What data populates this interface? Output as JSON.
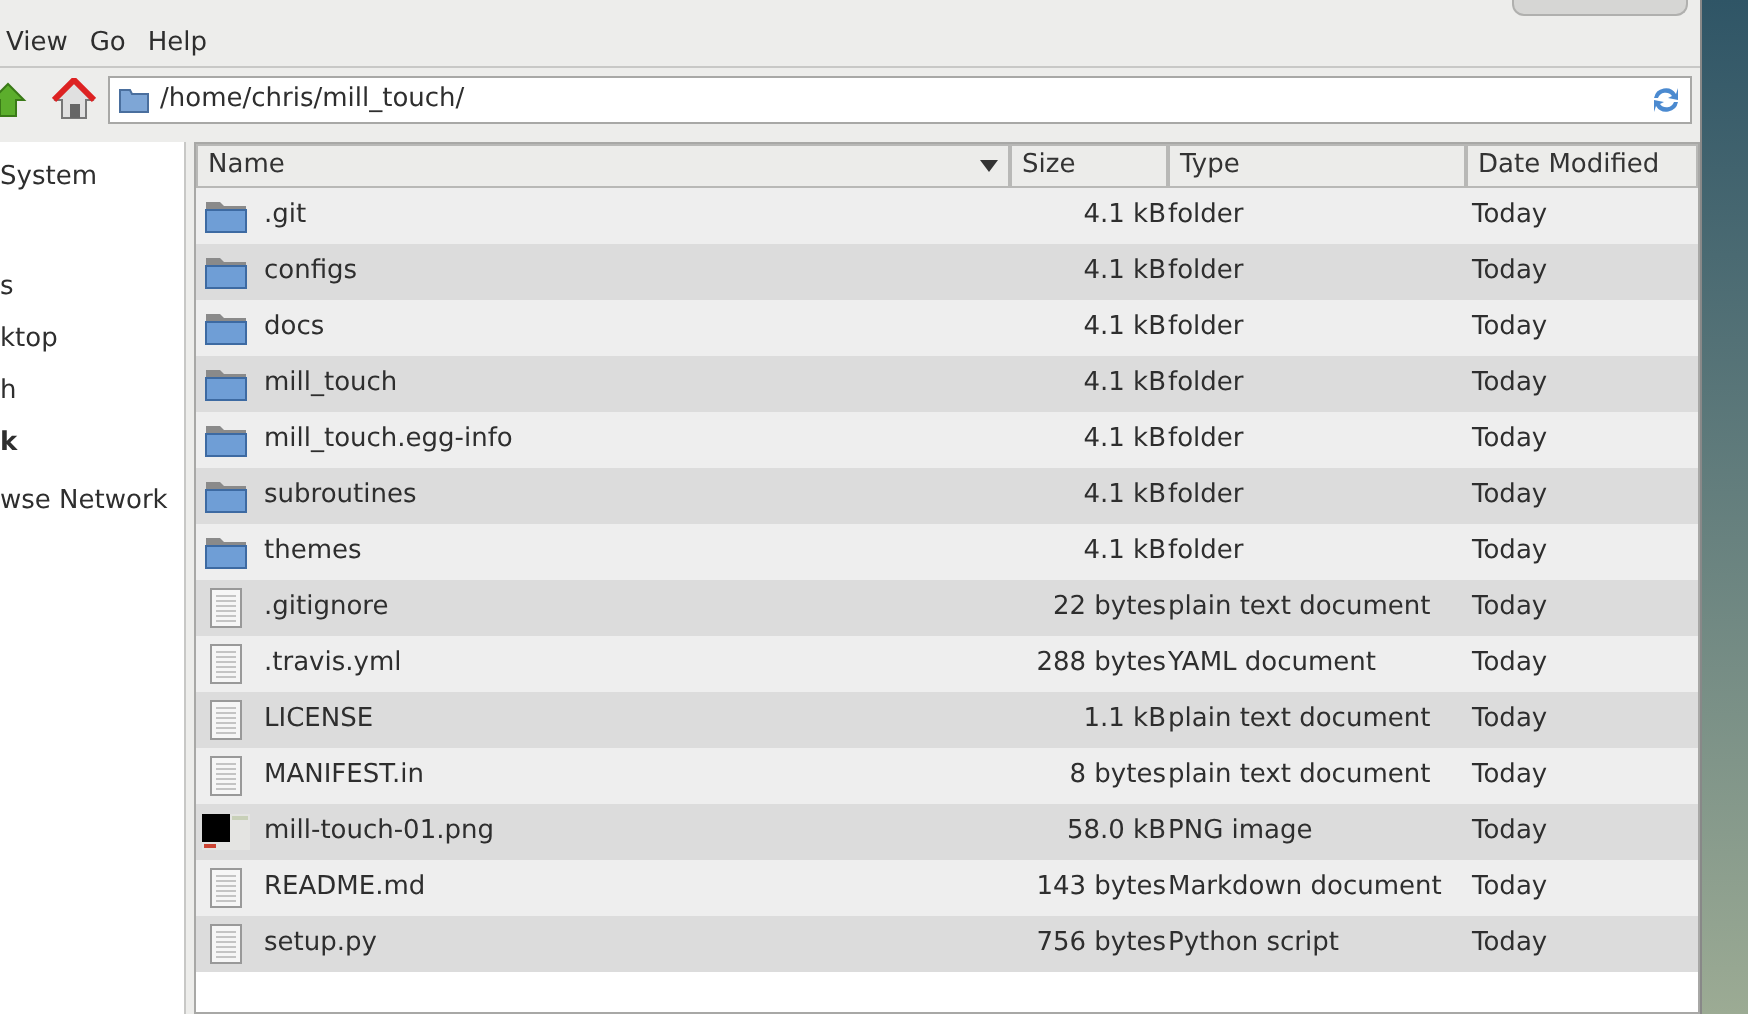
{
  "menu": [
    {
      "label": "View"
    },
    {
      "label": "Go"
    },
    {
      "label": "Help"
    }
  ],
  "location": {
    "value": "/home/chris/mill_touch/"
  },
  "sidebar": {
    "items": [
      {
        "label": "System",
        "selected": false
      },
      {
        "label": "s",
        "selected": false
      },
      {
        "label": "ktop",
        "selected": false
      },
      {
        "label": "h",
        "selected": false
      },
      {
        "label": "k",
        "selected": true
      },
      {
        "label": "wse Network",
        "selected": false
      }
    ]
  },
  "table": {
    "columns": [
      {
        "label": "Name",
        "sorted": true
      },
      {
        "label": "Size",
        "sorted": false
      },
      {
        "label": "Type",
        "sorted": false
      },
      {
        "label": "Date Modified",
        "sorted": false
      }
    ],
    "rows": [
      {
        "kind": "folder",
        "name": ".git",
        "size": "4.1 kB",
        "type": "folder",
        "modified": "Today"
      },
      {
        "kind": "folder",
        "name": "configs",
        "size": "4.1 kB",
        "type": "folder",
        "modified": "Today"
      },
      {
        "kind": "folder",
        "name": "docs",
        "size": "4.1 kB",
        "type": "folder",
        "modified": "Today"
      },
      {
        "kind": "folder",
        "name": "mill_touch",
        "size": "4.1 kB",
        "type": "folder",
        "modified": "Today"
      },
      {
        "kind": "folder",
        "name": "mill_touch.egg-info",
        "size": "4.1 kB",
        "type": "folder",
        "modified": "Today"
      },
      {
        "kind": "folder",
        "name": "subroutines",
        "size": "4.1 kB",
        "type": "folder",
        "modified": "Today"
      },
      {
        "kind": "folder",
        "name": "themes",
        "size": "4.1 kB",
        "type": "folder",
        "modified": "Today"
      },
      {
        "kind": "text",
        "name": ".gitignore",
        "size": "22 bytes",
        "type": "plain text document",
        "modified": "Today"
      },
      {
        "kind": "text",
        "name": ".travis.yml",
        "size": "288 bytes",
        "type": "YAML document",
        "modified": "Today"
      },
      {
        "kind": "text",
        "name": "LICENSE",
        "size": "1.1 kB",
        "type": "plain text document",
        "modified": "Today"
      },
      {
        "kind": "text",
        "name": "MANIFEST.in",
        "size": "8 bytes",
        "type": "plain text document",
        "modified": "Today"
      },
      {
        "kind": "image",
        "name": "mill-touch-01.png",
        "size": "58.0 kB",
        "type": "PNG image",
        "modified": "Today"
      },
      {
        "kind": "text",
        "name": "README.md",
        "size": "143 bytes",
        "type": "Markdown document",
        "modified": "Today"
      },
      {
        "kind": "text",
        "name": "setup.py",
        "size": "756 bytes",
        "type": "Python script",
        "modified": "Today"
      }
    ]
  }
}
